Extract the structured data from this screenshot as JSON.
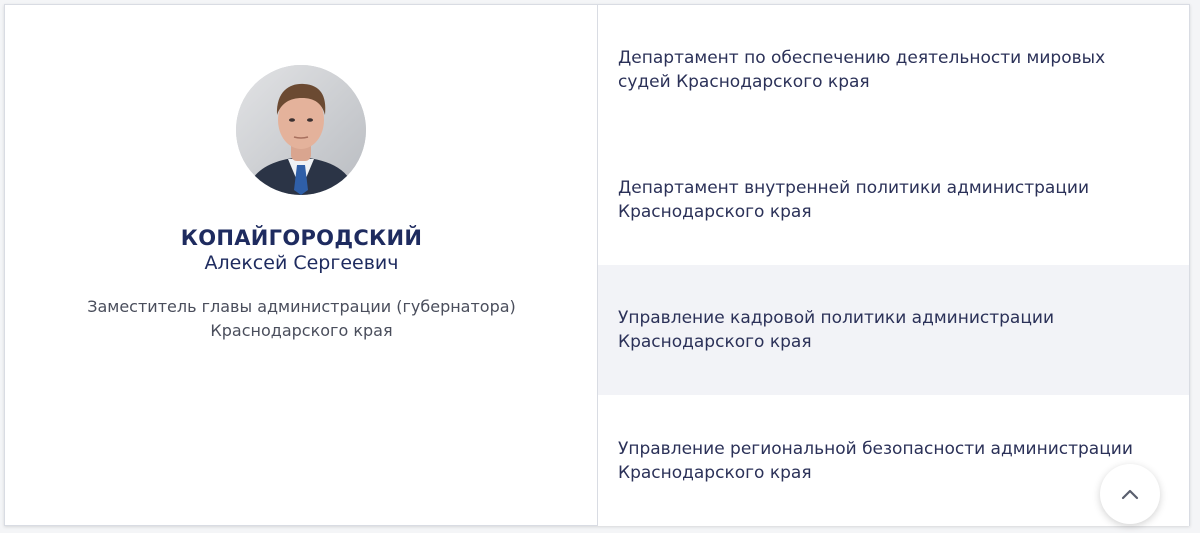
{
  "person": {
    "surname": "КОПАЙГОРОДСКИЙ",
    "given_names": "Алексей Сергеевич",
    "position": "Заместитель главы администрации (губернатора) Краснодарского края",
    "avatar_icon": "person-photo"
  },
  "departments": [
    {
      "label": "Департамент по обеспечению деятельности мировых судей Краснодарского края",
      "highlighted": false
    },
    {
      "label": "Департамент внутренней политики администрации Краснодарского края",
      "highlighted": false
    },
    {
      "label": "Управление кадровой политики администрации Краснодарского края",
      "highlighted": true
    },
    {
      "label": "Управление региональной безопасности администрации Краснодарского края",
      "highlighted": false
    }
  ],
  "scroll_top": {
    "icon": "chevron-up-icon"
  },
  "colors": {
    "name_text": "#1e2b5f",
    "dept_text": "#2b3158",
    "highlight_bg": "#f2f3f7",
    "border": "#d9dce3"
  }
}
